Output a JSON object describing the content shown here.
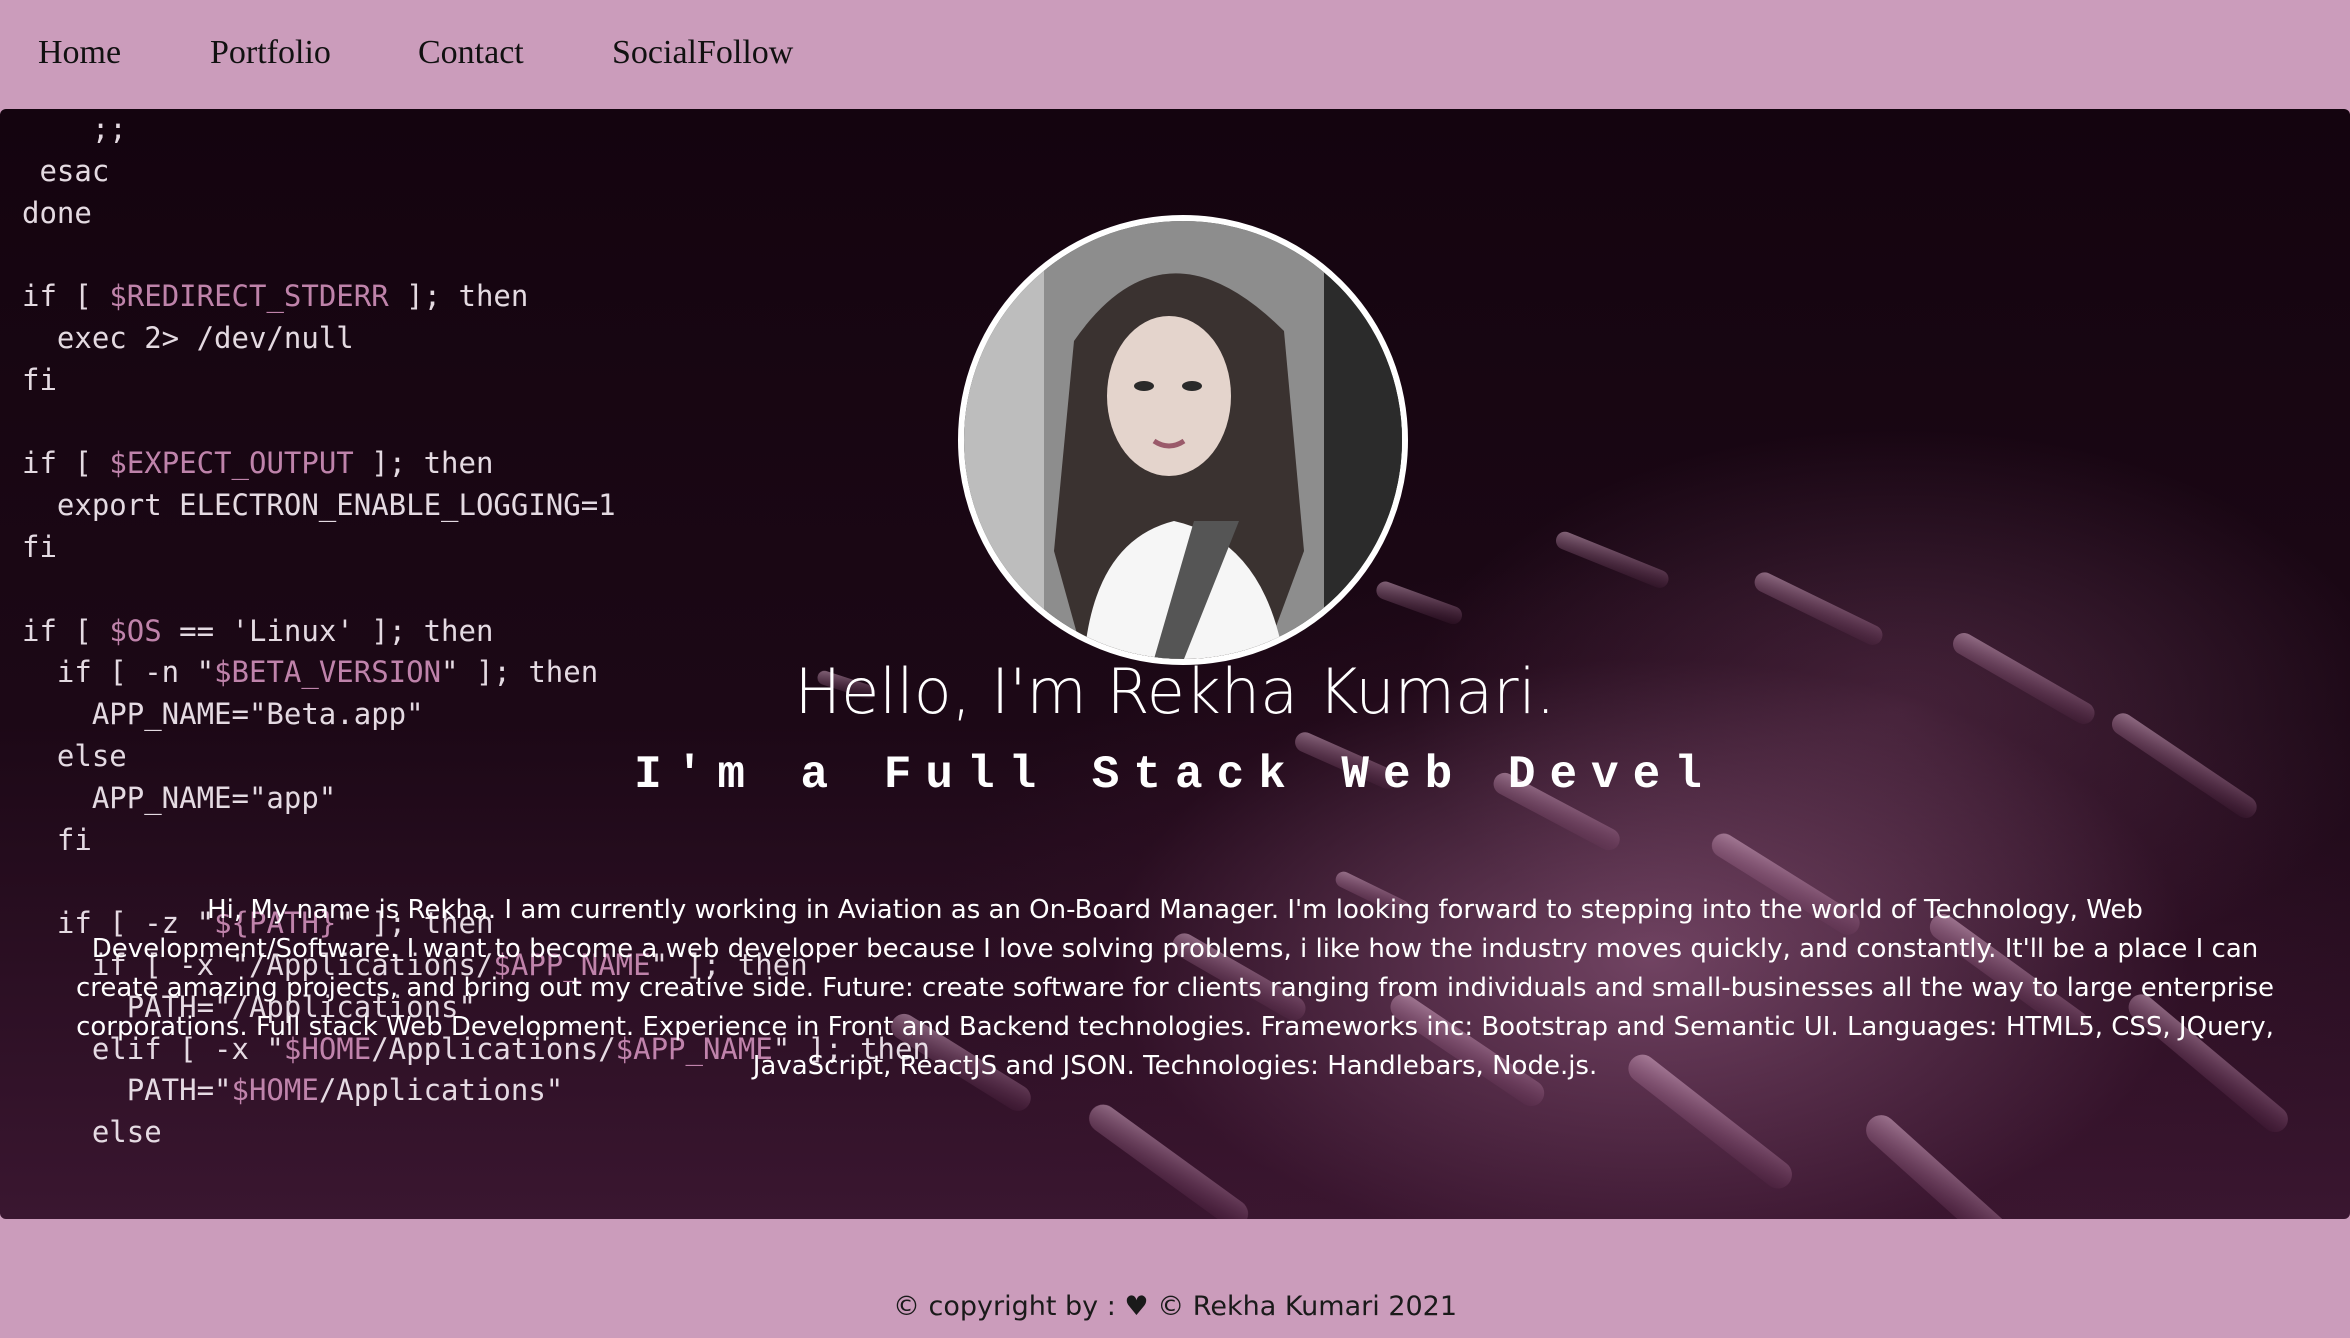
{
  "nav": {
    "items": [
      {
        "label": "Home"
      },
      {
        "label": "Portfolio"
      },
      {
        "label": "Contact"
      },
      {
        "label": "SocialFollow"
      }
    ]
  },
  "hero": {
    "greeting": "Hello, I'm Rekha Kumari.",
    "tagline": "I'm a Full Stack Web Devel",
    "bio": "Hi, My name is Rekha. I am currently working in Aviation as an On-Board Manager. I'm looking forward to stepping into the world of Technology, Web Development/Software. I want to become a web developer because I love solving problems, i like how the industry moves quickly, and constantly. It'll be a place I can create amazing projects, and bring out my creative side. Future: create software for clients ranging from individuals and small-businesses all the way to large enterprise corporations. Full stack Web Development. Experience in Front and Backend technologies. Frameworks inc: Bootstrap and Semantic UI. Languages: HTML5, CSS, JQuery, JavaScript, ReactJS and JSON. Technologies: Handlebars, Node.js.",
    "background_code": [
      "    ;;",
      " esac",
      "done",
      "",
      "if [ $REDIRECT_STDERR ]; then",
      "  exec 2> /dev/null",
      "fi",
      "",
      "if [ $EXPECT_OUTPUT ]; then",
      "  export ELECTRON_ENABLE_LOGGING=1",
      "fi",
      "",
      "if [ $OS == 'Linux' ]; then",
      "  if [ -n \"$BETA_VERSION\" ]; then",
      "    APP_NAME=\"Beta.app\"",
      "  else",
      "    APP_NAME=\"app\"",
      "  fi",
      "",
      "  if [ -z \"${PATH}\" ]; then",
      "    if [ -x \"/Applications/$APP_NAME\" ]; then",
      "      PATH=\"/Applications\"",
      "    elif [ -x \"$HOME/Applications/$APP_NAME\" ]; then",
      "      PATH=\"$HOME/Applications\"",
      "    else"
    ]
  },
  "footer": {
    "text": "© copyright by : ♥ © Rekha Kumari 2021"
  },
  "colors": {
    "nav_bg": "#cb9cbb",
    "hero_text": "#ffffff",
    "accent_code_var": "#c98bb4"
  }
}
